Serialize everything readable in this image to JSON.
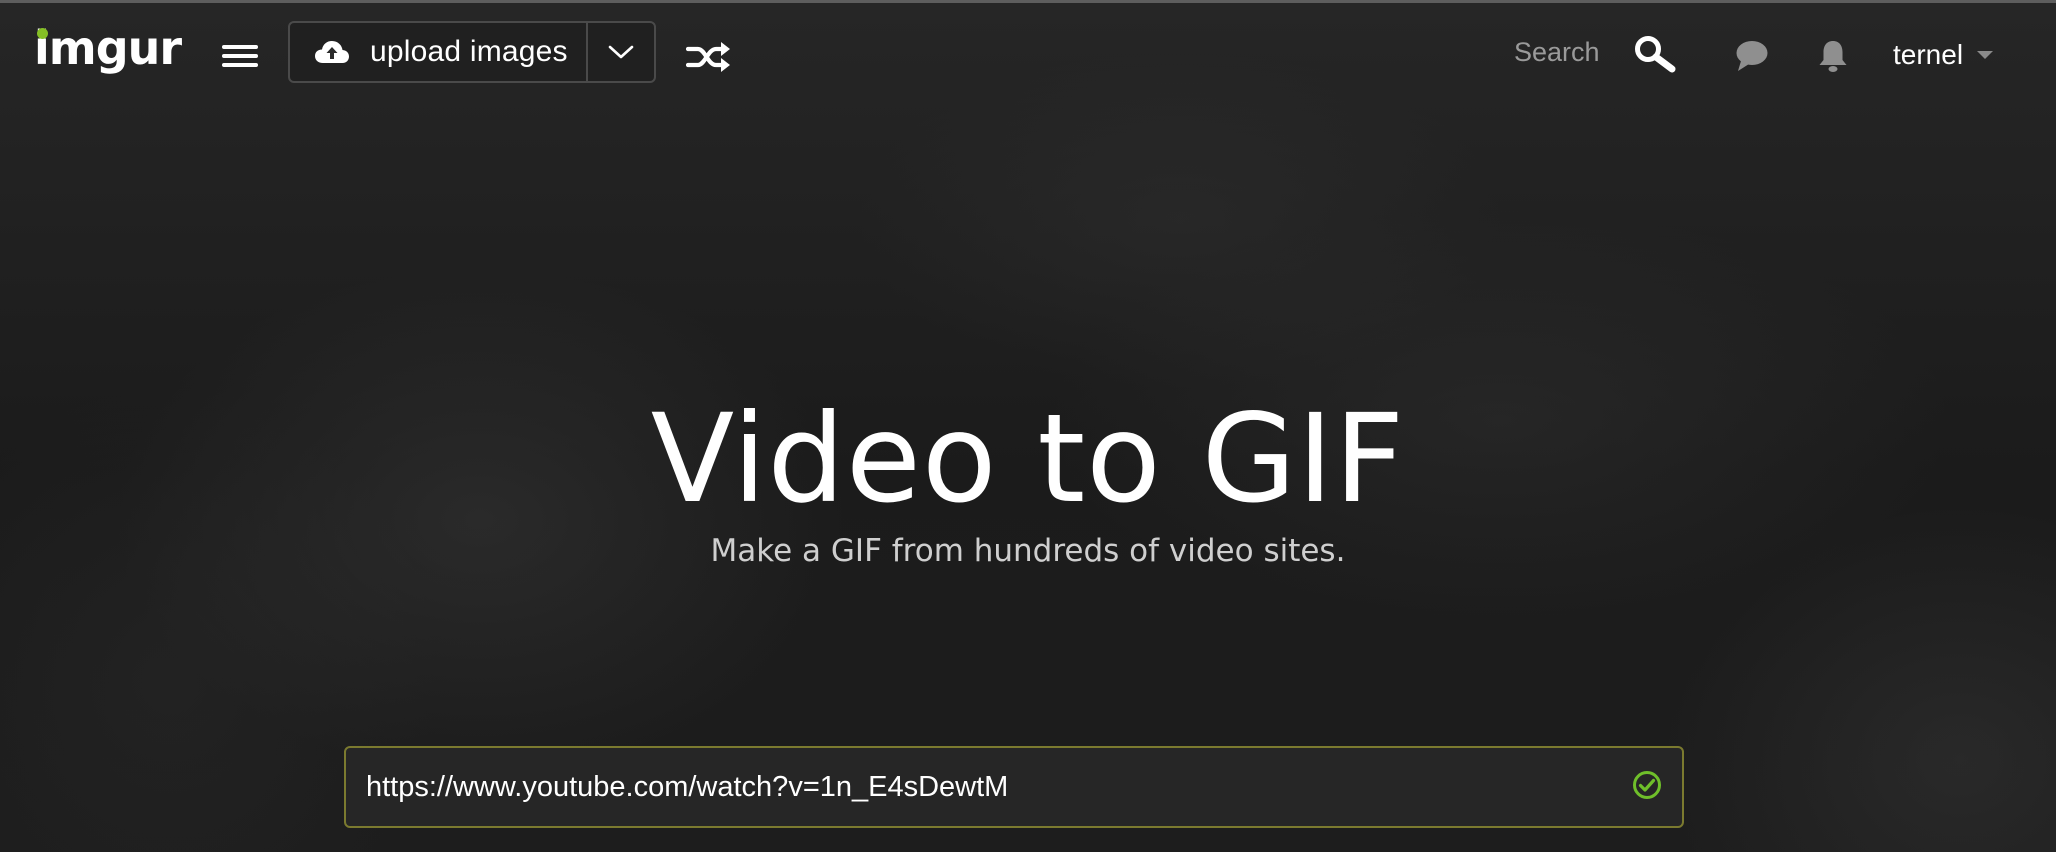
{
  "header": {
    "logo_text": "imgur",
    "upload_label": "upload images",
    "search_label": "Search",
    "username": "ternel",
    "icons": {
      "menu": "hamburger-icon",
      "upload": "cloud-upload-icon",
      "dropdown": "chevron-down-icon",
      "random": "shuffle-icon",
      "search": "search-icon",
      "messages": "chat-bubble-icon",
      "notifications": "bell-icon",
      "user_menu": "caret-down-icon"
    }
  },
  "hero": {
    "title": "Video to GIF",
    "subtitle": "Make a GIF from hundreds of video sites."
  },
  "url_input": {
    "value": "https://www.youtube.com/watch?v=1n_E4sDewtM",
    "status_icon": "check-circle-icon"
  },
  "colors": {
    "brand_green": "#85bf25",
    "input_border": "#7b7a2f",
    "check_green": "#6fbf2a",
    "background": "#1a1a1a"
  }
}
